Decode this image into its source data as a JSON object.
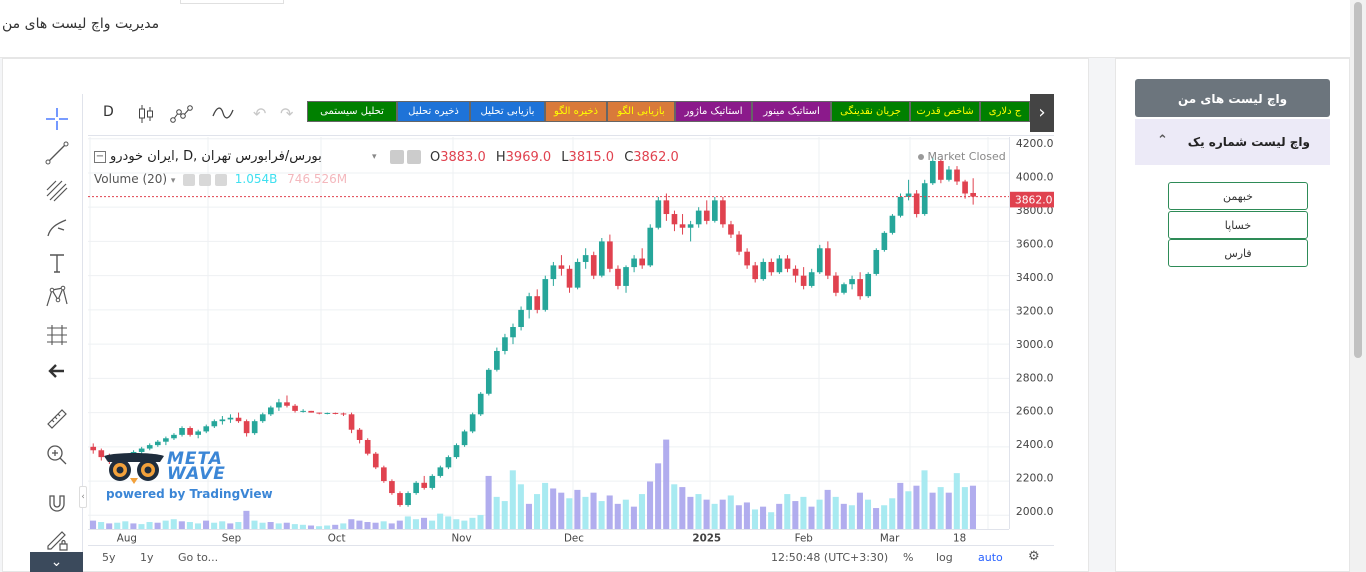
{
  "page": {
    "title": "مدیریت واچ لیست های من"
  },
  "watchlist": {
    "header": "واچ لیست های من",
    "list_name": "واچ لیست شماره یک",
    "items": [
      "خبهمن",
      "خساپا",
      "فارس"
    ]
  },
  "toolbar": {
    "interval": "D",
    "buttons": [
      {
        "label": "تحلیل سیستمی",
        "bg": "#008000",
        "fg": "#ffffff"
      },
      {
        "label": "ذخیره تحلیل",
        "bg": "#1e73d8",
        "fg": "#ffffff"
      },
      {
        "label": "بازیابی تحلیل",
        "bg": "#1e73d8",
        "fg": "#ffffff"
      },
      {
        "label": "ذخیره الگو",
        "bg": "#d97a3a",
        "fg": "#ffff00"
      },
      {
        "label": "بازیابی الگو",
        "bg": "#d97a3a",
        "fg": "#ffff00"
      },
      {
        "label": "استاتیک ماژور",
        "bg": "#8b1a8b",
        "fg": "#ffffff"
      },
      {
        "label": "استاتیک مینور",
        "bg": "#8b1a8b",
        "fg": "#ffffff"
      },
      {
        "label": "جریان نقدینگی",
        "bg": "#008000",
        "fg": "#ffff00"
      },
      {
        "label": "شاخص قدرت",
        "bg": "#008000",
        "fg": "#ffff00"
      },
      {
        "label": "ج دلاری",
        "bg": "#008000",
        "fg": "#ffff00"
      }
    ]
  },
  "legend": {
    "symbol": "بورس/فرابورس تهران ,D ,ایران خودرو",
    "open_label": "O",
    "open": "3883.0",
    "high_label": "H",
    "high": "3969.0",
    "low_label": "L",
    "low": "3815.0",
    "close_label": "C",
    "close": "3862.0",
    "volume_label": "Volume (20)",
    "volume_value": "1.054B",
    "volume_ma": "746.526M",
    "market_status": "Market Closed"
  },
  "watermark": {
    "brand": "META WAVE",
    "powered": "powered by TradingView"
  },
  "bottom": {
    "range_5y": "5y",
    "range_1y": "1y",
    "goto": "Go to...",
    "time": "12:50:48 (UTC+3:30)",
    "percent": "%",
    "log": "log",
    "auto": "auto"
  },
  "colors": {
    "up": "#26a69a",
    "down": "#e0424f",
    "accent": "#2962ff"
  },
  "chart_data": {
    "type": "candlestick",
    "y_ticks": [
      "4200.0",
      "4000.0",
      "3800.0",
      "3600.0",
      "3400.0",
      "3200.0",
      "3000.0",
      "2800.0",
      "2600.0",
      "2400.0",
      "2200.0",
      "2000.0"
    ],
    "ylim": [
      1920,
      4210
    ],
    "x_ticks": [
      "Aug",
      "Sep",
      "Oct",
      "Nov",
      "Dec",
      "2025",
      "Feb",
      "Mar",
      "18"
    ],
    "last_price": "3862.0",
    "ohlc": [
      [
        2400,
        2420,
        2360,
        2380
      ],
      [
        2380,
        2390,
        2320,
        2340
      ],
      [
        2340,
        2360,
        2300,
        2320
      ],
      [
        2320,
        2340,
        2290,
        2330
      ],
      [
        2330,
        2350,
        2310,
        2340
      ],
      [
        2340,
        2380,
        2330,
        2370
      ],
      [
        2370,
        2400,
        2360,
        2390
      ],
      [
        2390,
        2420,
        2380,
        2410
      ],
      [
        2410,
        2440,
        2400,
        2430
      ],
      [
        2430,
        2460,
        2410,
        2450
      ],
      [
        2450,
        2480,
        2440,
        2470
      ],
      [
        2470,
        2520,
        2460,
        2510
      ],
      [
        2510,
        2520,
        2460,
        2470
      ],
      [
        2470,
        2500,
        2450,
        2490
      ],
      [
        2490,
        2530,
        2480,
        2520
      ],
      [
        2520,
        2560,
        2510,
        2550
      ],
      [
        2550,
        2580,
        2530,
        2560
      ],
      [
        2560,
        2590,
        2540,
        2570
      ],
      [
        2570,
        2600,
        2540,
        2550
      ],
      [
        2550,
        2560,
        2460,
        2480
      ],
      [
        2480,
        2560,
        2470,
        2550
      ],
      [
        2550,
        2600,
        2540,
        2590
      ],
      [
        2590,
        2640,
        2580,
        2630
      ],
      [
        2630,
        2680,
        2610,
        2660
      ],
      [
        2660,
        2700,
        2630,
        2640
      ],
      [
        2640,
        2650,
        2600,
        2610
      ],
      [
        2610,
        2620,
        2600,
        2610
      ],
      [
        2610,
        2610,
        2600,
        2600
      ],
      [
        2600,
        2600,
        2590,
        2595
      ],
      [
        2595,
        2600,
        2590,
        2598
      ],
      [
        2598,
        2600,
        2590,
        2595
      ],
      [
        2595,
        2600,
        2580,
        2590
      ],
      [
        2590,
        2600,
        2480,
        2500
      ],
      [
        2500,
        2510,
        2420,
        2440
      ],
      [
        2440,
        2450,
        2350,
        2360
      ],
      [
        2360,
        2370,
        2270,
        2280
      ],
      [
        2280,
        2290,
        2190,
        2200
      ],
      [
        2200,
        2210,
        2120,
        2130
      ],
      [
        2130,
        2140,
        2050,
        2060
      ],
      [
        2060,
        2140,
        2050,
        2130
      ],
      [
        2130,
        2200,
        2120,
        2190
      ],
      [
        2190,
        2230,
        2150,
        2160
      ],
      [
        2160,
        2240,
        2150,
        2230
      ],
      [
        2230,
        2290,
        2220,
        2280
      ],
      [
        2280,
        2350,
        2270,
        2340
      ],
      [
        2340,
        2420,
        2330,
        2410
      ],
      [
        2410,
        2500,
        2400,
        2490
      ],
      [
        2490,
        2600,
        2480,
        2590
      ],
      [
        2590,
        2720,
        2580,
        2710
      ],
      [
        2710,
        2860,
        2700,
        2850
      ],
      [
        2850,
        2980,
        2840,
        2960
      ],
      [
        2960,
        3060,
        2940,
        3040
      ],
      [
        3040,
        3120,
        3000,
        3100
      ],
      [
        3100,
        3220,
        3080,
        3200
      ],
      [
        3200,
        3300,
        3150,
        3280
      ],
      [
        3280,
        3320,
        3180,
        3200
      ],
      [
        3200,
        3400,
        3190,
        3380
      ],
      [
        3380,
        3480,
        3340,
        3460
      ],
      [
        3460,
        3520,
        3400,
        3440
      ],
      [
        3440,
        3460,
        3300,
        3330
      ],
      [
        3330,
        3500,
        3320,
        3480
      ],
      [
        3480,
        3560,
        3440,
        3520
      ],
      [
        3520,
        3540,
        3380,
        3400
      ],
      [
        3400,
        3620,
        3390,
        3600
      ],
      [
        3600,
        3640,
        3420,
        3440
      ],
      [
        3440,
        3460,
        3320,
        3340
      ],
      [
        3340,
        3460,
        3300,
        3450
      ],
      [
        3450,
        3520,
        3420,
        3500
      ],
      [
        3500,
        3560,
        3440,
        3460
      ],
      [
        3460,
        3700,
        3450,
        3680
      ],
      [
        3680,
        3860,
        3670,
        3840
      ],
      [
        3840,
        3880,
        3720,
        3760
      ],
      [
        3760,
        3780,
        3660,
        3700
      ],
      [
        3700,
        3760,
        3640,
        3680
      ],
      [
        3680,
        3720,
        3600,
        3700
      ],
      [
        3700,
        3800,
        3680,
        3780
      ],
      [
        3780,
        3840,
        3700,
        3720
      ],
      [
        3720,
        3860,
        3710,
        3840
      ],
      [
        3840,
        3860,
        3680,
        3700
      ],
      [
        3700,
        3720,
        3620,
        3640
      ],
      [
        3640,
        3660,
        3520,
        3540
      ],
      [
        3540,
        3560,
        3440,
        3460
      ],
      [
        3460,
        3480,
        3360,
        3380
      ],
      [
        3380,
        3500,
        3370,
        3480
      ],
      [
        3480,
        3500,
        3400,
        3420
      ],
      [
        3420,
        3520,
        3410,
        3500
      ],
      [
        3500,
        3520,
        3420,
        3440
      ],
      [
        3440,
        3460,
        3360,
        3400
      ],
      [
        3400,
        3450,
        3320,
        3340
      ],
      [
        3340,
        3440,
        3330,
        3420
      ],
      [
        3420,
        3580,
        3410,
        3560
      ],
      [
        3560,
        3600,
        3380,
        3400
      ],
      [
        3400,
        3420,
        3280,
        3300
      ],
      [
        3300,
        3360,
        3290,
        3350
      ],
      [
        3350,
        3400,
        3320,
        3380
      ],
      [
        3380,
        3420,
        3260,
        3280
      ],
      [
        3280,
        3420,
        3270,
        3410
      ],
      [
        3410,
        3560,
        3400,
        3550
      ],
      [
        3550,
        3660,
        3540,
        3650
      ],
      [
        3650,
        3760,
        3640,
        3750
      ],
      [
        3750,
        3880,
        3740,
        3860
      ],
      [
        3860,
        3960,
        3840,
        3880
      ],
      [
        3880,
        3900,
        3740,
        3760
      ],
      [
        3760,
        3960,
        3750,
        3940
      ],
      [
        3940,
        4090,
        3930,
        4070
      ],
      [
        4070,
        4080,
        3940,
        3960
      ],
      [
        3960,
        4040,
        3950,
        4020
      ],
      [
        4020,
        4040,
        3930,
        3950
      ],
      [
        3950,
        3960,
        3850,
        3880
      ],
      [
        3883,
        3969,
        3815,
        3862
      ]
    ],
    "volume": [
      [
        60,
        "d"
      ],
      [
        50,
        "u"
      ],
      [
        40,
        "d"
      ],
      [
        45,
        "u"
      ],
      [
        55,
        "u"
      ],
      [
        40,
        "d"
      ],
      [
        35,
        "u"
      ],
      [
        50,
        "u"
      ],
      [
        45,
        "d"
      ],
      [
        60,
        "u"
      ],
      [
        70,
        "u"
      ],
      [
        55,
        "d"
      ],
      [
        50,
        "u"
      ],
      [
        40,
        "u"
      ],
      [
        60,
        "d"
      ],
      [
        45,
        "u"
      ],
      [
        55,
        "u"
      ],
      [
        40,
        "d"
      ],
      [
        50,
        "u"
      ],
      [
        130,
        "d"
      ],
      [
        60,
        "u"
      ],
      [
        45,
        "u"
      ],
      [
        50,
        "d"
      ],
      [
        40,
        "u"
      ],
      [
        45,
        "d"
      ],
      [
        35,
        "u"
      ],
      [
        30,
        "u"
      ],
      [
        25,
        "d"
      ],
      [
        20,
        "u"
      ],
      [
        25,
        "u"
      ],
      [
        30,
        "d"
      ],
      [
        40,
        "u"
      ],
      [
        70,
        "d"
      ],
      [
        60,
        "d"
      ],
      [
        50,
        "d"
      ],
      [
        45,
        "d"
      ],
      [
        55,
        "u"
      ],
      [
        40,
        "d"
      ],
      [
        60,
        "d"
      ],
      [
        90,
        "u"
      ],
      [
        70,
        "u"
      ],
      [
        80,
        "d"
      ],
      [
        60,
        "u"
      ],
      [
        110,
        "u"
      ],
      [
        90,
        "u"
      ],
      [
        70,
        "u"
      ],
      [
        60,
        "u"
      ],
      [
        80,
        "u"
      ],
      [
        100,
        "u"
      ],
      [
        380,
        "d"
      ],
      [
        230,
        "u"
      ],
      [
        200,
        "u"
      ],
      [
        420,
        "u"
      ],
      [
        320,
        "u"
      ],
      [
        180,
        "d"
      ],
      [
        250,
        "u"
      ],
      [
        330,
        "u"
      ],
      [
        290,
        "d"
      ],
      [
        260,
        "d"
      ],
      [
        220,
        "u"
      ],
      [
        280,
        "d"
      ],
      [
        230,
        "u"
      ],
      [
        260,
        "d"
      ],
      [
        200,
        "u"
      ],
      [
        240,
        "d"
      ],
      [
        180,
        "d"
      ],
      [
        210,
        "u"
      ],
      [
        160,
        "d"
      ],
      [
        250,
        "u"
      ],
      [
        340,
        "d"
      ],
      [
        470,
        "d"
      ],
      [
        640,
        "d"
      ],
      [
        320,
        "u"
      ],
      [
        300,
        "d"
      ],
      [
        230,
        "d"
      ],
      [
        250,
        "u"
      ],
      [
        210,
        "d"
      ],
      [
        180,
        "u"
      ],
      [
        210,
        "d"
      ],
      [
        240,
        "u"
      ],
      [
        170,
        "d"
      ],
      [
        190,
        "d"
      ],
      [
        140,
        "u"
      ],
      [
        160,
        "d"
      ],
      [
        120,
        "u"
      ],
      [
        180,
        "d"
      ],
      [
        250,
        "u"
      ],
      [
        200,
        "d"
      ],
      [
        230,
        "u"
      ],
      [
        160,
        "d"
      ],
      [
        210,
        "u"
      ],
      [
        280,
        "d"
      ],
      [
        230,
        "u"
      ],
      [
        180,
        "d"
      ],
      [
        170,
        "u"
      ],
      [
        260,
        "d"
      ],
      [
        210,
        "u"
      ],
      [
        150,
        "d"
      ],
      [
        170,
        "u"
      ],
      [
        220,
        "u"
      ],
      [
        330,
        "d"
      ],
      [
        270,
        "u"
      ],
      [
        310,
        "d"
      ],
      [
        420,
        "u"
      ],
      [
        260,
        "d"
      ],
      [
        300,
        "u"
      ],
      [
        260,
        "d"
      ],
      [
        400,
        "u"
      ],
      [
        300,
        "u"
      ],
      [
        310,
        "d"
      ]
    ]
  }
}
